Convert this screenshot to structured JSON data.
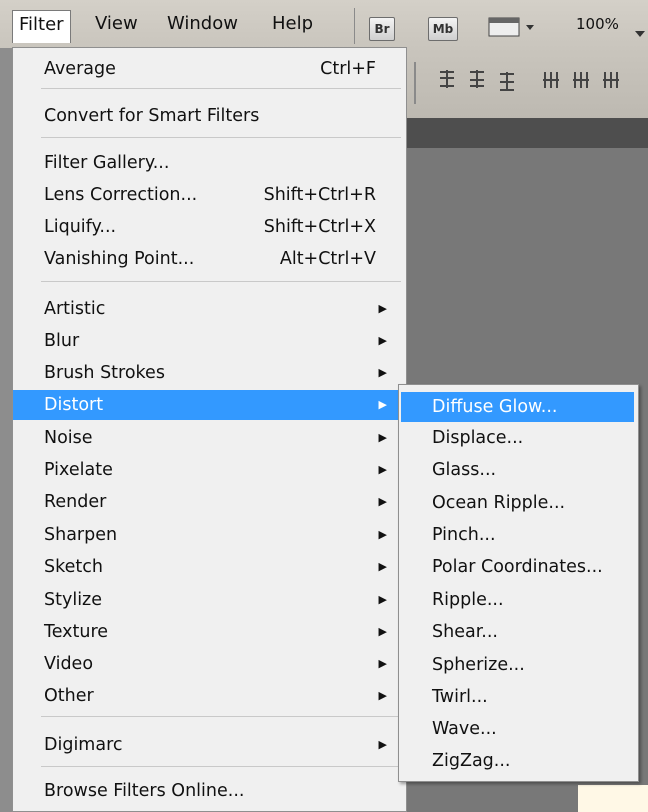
{
  "menubar": {
    "items": [
      "Filter",
      "View",
      "Window",
      "Help"
    ],
    "br_label": "Br",
    "mb_label": "Mb",
    "zoom": "100%"
  },
  "filter_menu": {
    "last_filter": {
      "label": "Average",
      "shortcut": "Ctrl+F"
    },
    "convert": "Convert for Smart Filters",
    "tools": [
      {
        "label": "Filter Gallery...",
        "shortcut": ""
      },
      {
        "label": "Lens Correction...",
        "shortcut": "Shift+Ctrl+R"
      },
      {
        "label": "Liquify...",
        "shortcut": "Shift+Ctrl+X"
      },
      {
        "label": "Vanishing Point...",
        "shortcut": "Alt+Ctrl+V"
      }
    ],
    "groups": [
      "Artistic",
      "Blur",
      "Brush Strokes",
      "Distort",
      "Noise",
      "Pixelate",
      "Render",
      "Sharpen",
      "Sketch",
      "Stylize",
      "Texture",
      "Video",
      "Other"
    ],
    "digimarc": "Digimarc",
    "browse": "Browse Filters Online..."
  },
  "distort_submenu": {
    "items": [
      "Diffuse Glow...",
      "Displace...",
      "Glass...",
      "Ocean Ripple...",
      "Pinch...",
      "Polar Coordinates...",
      "Ripple...",
      "Shear...",
      "Spherize...",
      "Twirl...",
      "Wave...",
      "ZigZag..."
    ]
  },
  "colors": {
    "highlight": "#3399ff",
    "menu_bg": "#f0f0f0"
  }
}
